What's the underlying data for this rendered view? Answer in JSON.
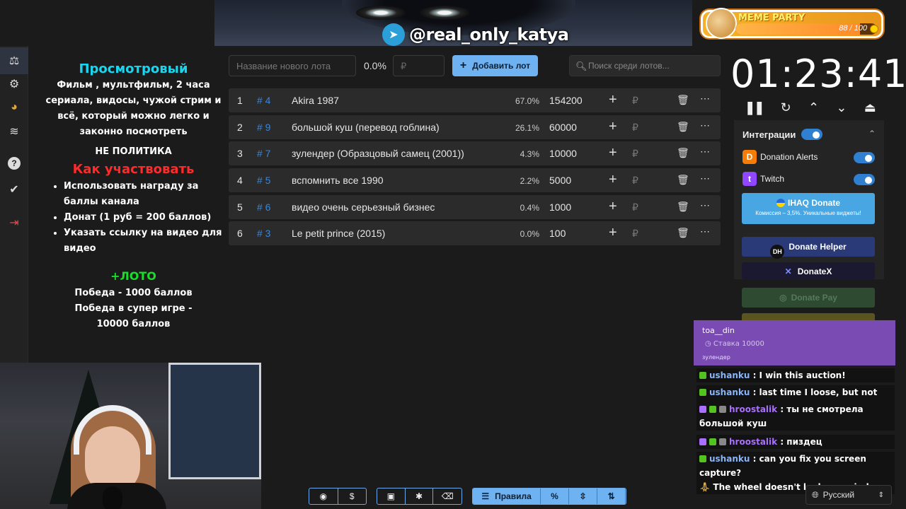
{
  "banner": {
    "telegram_handle": "@real_only_katya",
    "telegram_icon": "telegram-icon"
  },
  "meme_party": {
    "title": "MEME PARTY",
    "progress_text": "88 / 100",
    "progress": 0.88,
    "icon": "doge-avatar"
  },
  "sidebar": {
    "items": [
      {
        "name": "auction-icon",
        "glyph": "⚖"
      },
      {
        "name": "settings-icon",
        "glyph": "⚙"
      },
      {
        "name": "wheel-icon",
        "glyph": "◕"
      },
      {
        "name": "layers-icon",
        "glyph": "≋"
      },
      {
        "name": "help-icon",
        "glyph": "?"
      },
      {
        "name": "shield-icon",
        "glyph": "✔"
      },
      {
        "name": "logout-icon",
        "glyph": "⇥"
      }
    ]
  },
  "rules": {
    "heading": "Просмотровый",
    "description": "Фильм , мультфильм, 2 часа сериала, видосы, чужой стрим и всё, который можно легко и законно посмотреть",
    "no_politics": "НЕ ПОЛИТИКА",
    "how_to": "Как участвовать",
    "steps": [
      "Использовать награду за баллы канала",
      "Донат (1 руб = 200 баллов)",
      "Указать ссылку на видео для видео"
    ],
    "loto": "+ЛОТО",
    "win": "Победа - 1000 баллов",
    "win_super": "Победа в супер игре - 10000 баллов"
  },
  "toolbar": {
    "lot_name_placeholder": "Название нового лота",
    "percent": "0.0%",
    "amount_placeholder": "₽",
    "add_button": "Добавить лот",
    "search_placeholder": "Поиск среди лотов..."
  },
  "lots": [
    {
      "n": "1",
      "id": "# 4",
      "name": "Akira 1987",
      "pct": "67.0%",
      "amount": "154200"
    },
    {
      "n": "2",
      "id": "# 9",
      "name": "большой куш (перевод гоблина)",
      "pct": "26.1%",
      "amount": "60000"
    },
    {
      "n": "3",
      "id": "# 7",
      "name": "зулендер (Образцовый самец (2001))",
      "pct": "4.3%",
      "amount": "10000"
    },
    {
      "n": "4",
      "id": "# 5",
      "name": "вспомнить все 1990",
      "pct": "2.2%",
      "amount": "5000"
    },
    {
      "n": "5",
      "id": "# 6",
      "name": "видео очень серьезный бизнес",
      "pct": "0.4%",
      "amount": "1000"
    },
    {
      "n": "6",
      "id": "# 3",
      "name": "Le petit prince (2015)",
      "pct": "0.0%",
      "amount": "100"
    }
  ],
  "lot_row": {
    "plus": "+",
    "currency": "₽",
    "trash": "🗑",
    "more": "⋯"
  },
  "timer": {
    "value": "01:23:41"
  },
  "integrations": {
    "title": "Интеграции",
    "services": [
      {
        "label": "Donation Alerts",
        "icon": "donation-alerts-icon",
        "color": "#f57d07",
        "glyph": "D"
      },
      {
        "label": "Twitch",
        "icon": "twitch-icon",
        "color": "#9146ff",
        "glyph": "t"
      }
    ],
    "ihaq": {
      "title": "IHAQ Donate",
      "subtitle": "Комиссия – 3,5%. Уникальные виджеты!"
    },
    "donate_helper": "Donate Helper",
    "donatex": "DonateX",
    "donate_pay": "Donate Pay"
  },
  "chat": {
    "highlight": {
      "user": "toa__din",
      "bet": "Ставка 10000",
      "lot": "зулендер"
    },
    "messages": [
      {
        "user": "ushanku",
        "text": " : I win this auction!",
        "color": "blue"
      },
      {
        "user": "ushanku",
        "text": " : last time I loose, but not today",
        "color": "blue"
      },
      {
        "user": "hroostalik",
        "text": " : ты не смотрела большой куш",
        "color": "purple"
      },
      {
        "user": "hroostalik",
        "text": " : пиздец",
        "color": "purple"
      },
      {
        "user": "ushanku",
        "text": " : can you fix you screen capture?",
        "color": "blue"
      },
      {
        "user": "",
        "text": "The wheel doesn't look as a circle",
        "color": "blue"
      }
    ]
  },
  "bottom": {
    "rules_label": "Правила",
    "percent_label": "%"
  },
  "language": {
    "value": "Русский"
  }
}
